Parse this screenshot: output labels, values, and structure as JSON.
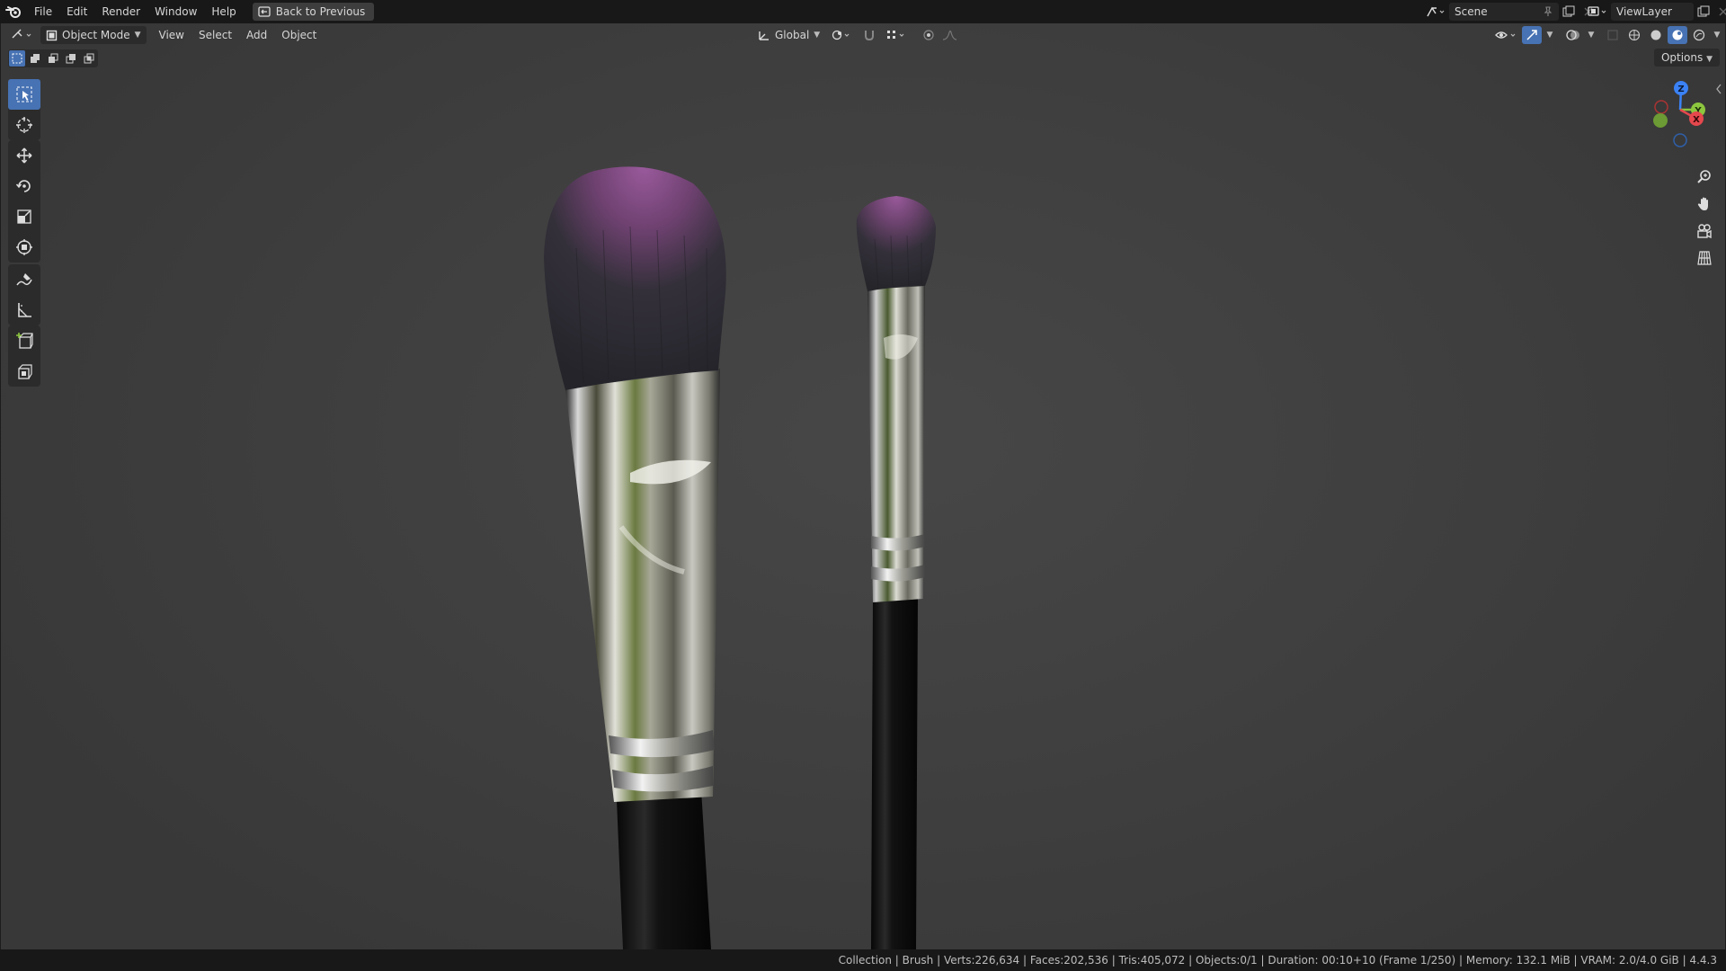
{
  "menu": {
    "items": [
      "File",
      "Edit",
      "Render",
      "Window",
      "Help"
    ],
    "back_label": "Back to Previous"
  },
  "scene": {
    "label": "Scene"
  },
  "view_layer": {
    "label": "ViewLayer"
  },
  "viewport_header": {
    "mode": "Object Mode",
    "menus": [
      "View",
      "Select",
      "Add",
      "Object"
    ],
    "transform_orientation": "Global",
    "options_label": "Options"
  },
  "gizmo": {
    "z": "Z",
    "y": "Y",
    "x": "X"
  },
  "status": {
    "text": "Collection | Brush | Verts:226,634 | Faces:202,536 | Tris:405,072 | Objects:0/1 | Duration: 00:10+10 (Frame 1/250) | Memory: 132.1 MiB | VRAM: 2.0/4.0 GiB | 4.4.3"
  },
  "colors": {
    "accent": "#4772b3",
    "axis_x": "#e5484d",
    "axis_y": "#8cc63e",
    "axis_z": "#3b82f6",
    "bristle_tip": "#8a4f8a"
  },
  "toolbar_tools": [
    "select-box",
    "cursor",
    "move",
    "rotate",
    "scale",
    "transform",
    "annotate",
    "measure",
    "add-cube",
    "add-cube-alt"
  ]
}
